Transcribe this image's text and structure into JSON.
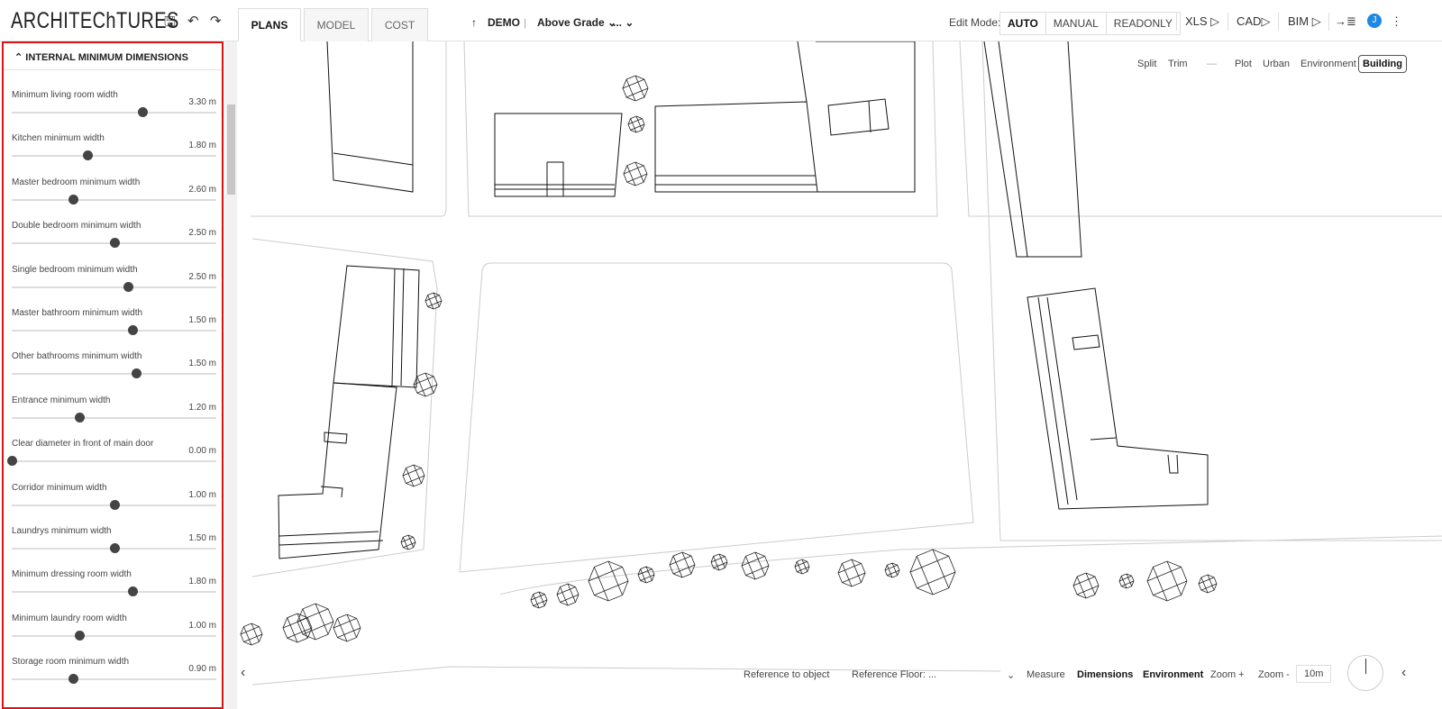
{
  "app": {
    "logo": "ARCHITEChTURES"
  },
  "toolbar": {
    "save_icon": "save-icon",
    "undo_icon": "undo-icon",
    "redo_icon": "redo-icon"
  },
  "tabs": [
    {
      "label": "PLANS",
      "active": true
    },
    {
      "label": "MODEL"
    },
    {
      "label": "COST"
    }
  ],
  "breadcrumb": {
    "arrow": "↑",
    "project": "DEMO",
    "level": "Above Grade",
    "more": "..."
  },
  "edit_mode": {
    "label": "Edit Mode:",
    "options": [
      "AUTO",
      "MANUAL",
      "READONLY"
    ],
    "selected": "AUTO"
  },
  "exports": [
    "XLS ▷",
    "CAD▷",
    "BIM ▷"
  ],
  "user": {
    "initial": "J",
    "color": "#1e88e5"
  },
  "panel": {
    "title": "INTERNAL MINIMUM DIMENSIONS",
    "items": [
      {
        "label": "Minimum living room width",
        "value": "3.30 m",
        "slider": 0.64
      },
      {
        "label": "Kitchen minimum width",
        "value": "1.80 m",
        "slider": 0.37
      },
      {
        "label": "Master bedroom minimum width",
        "value": "2.60 m",
        "slider": 0.3
      },
      {
        "label": "Double bedroom minimum width",
        "value": "2.50 m",
        "slider": 0.5
      },
      {
        "label": "Single bedroom minimum width",
        "value": "2.50 m",
        "slider": 0.57
      },
      {
        "label": "Master bathroom minimum width",
        "value": "1.50 m",
        "slider": 0.59
      },
      {
        "label": "Other bathrooms minimum width",
        "value": "1.50 m",
        "slider": 0.61
      },
      {
        "label": "Entrance minimum width",
        "value": "1.20 m",
        "slider": 0.33
      },
      {
        "label": "Clear diameter in front of main door",
        "value": "0.00 m",
        "slider": 0.0
      },
      {
        "label": "Corridor minimum width",
        "value": "1.00 m",
        "slider": 0.5
      },
      {
        "label": "Laundrys minimum width",
        "value": "1.50 m",
        "slider": 0.5
      },
      {
        "label": "Minimum dressing room width",
        "value": "1.80 m",
        "slider": 0.59
      },
      {
        "label": "Minimum laundry room width",
        "value": "1.00 m",
        "slider": 0.33
      },
      {
        "label": "Storage room minimum width",
        "value": "0.90 m",
        "slider": 0.3
      }
    ]
  },
  "map_tools": {
    "split": "Split",
    "trim": "Trim",
    "dash": "—",
    "layers": [
      "Plot",
      "Urban",
      "Environment",
      "Building"
    ],
    "active_layer": "Building"
  },
  "bottom": {
    "reference_object": "Reference to object",
    "reference_floor": "Reference Floor:  ...",
    "measure": "Measure",
    "dimensions": "Dimensions",
    "environment": "Environment",
    "zoom_in": "Zoom +",
    "zoom_out": "Zoom -",
    "scale": "10m"
  }
}
